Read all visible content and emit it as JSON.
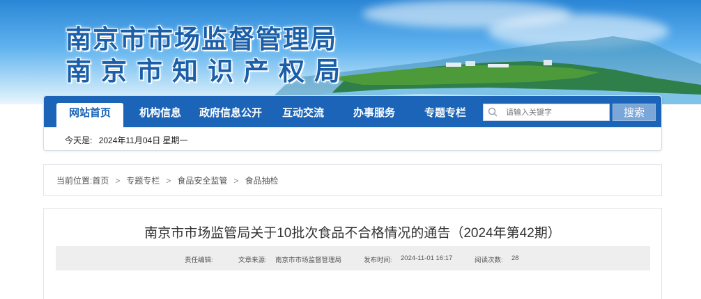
{
  "banner": {
    "line1": "南京市市场监督管理局",
    "line2": "南京市知识产权局"
  },
  "nav": {
    "items": [
      {
        "label": "网站首页",
        "active": true
      },
      {
        "label": "机构信息"
      },
      {
        "label": "政府信息公开"
      },
      {
        "label": "互动交流"
      },
      {
        "label": "办事服务"
      },
      {
        "label": "专题专栏"
      }
    ],
    "search_placeholder": "请输入关键字",
    "search_button": "搜索",
    "date_prefix": "今天是:",
    "date_value": "2024年11月04日 星期一"
  },
  "breadcrumb": {
    "prefix": "当前位置:",
    "items": [
      "首页",
      "专题专栏",
      "食品安全监管",
      "食品抽检"
    ],
    "separator": ">"
  },
  "article": {
    "title": "南京市市场监管局关于10批次食品不合格情况的通告（2024年第42期）",
    "editor_label": "责任编辑:",
    "source_label": "文章来源:",
    "source_value": "南京市市场监督管理局",
    "published_label": "发布时间:",
    "published_value": "2024-11-01 16:17",
    "views_label": "阅读次数:",
    "views_value": "28"
  },
  "colors": {
    "nav_blue": "#1b64b7",
    "search_button": "#7aa6d8",
    "title_blue": "#1a5fa8"
  }
}
